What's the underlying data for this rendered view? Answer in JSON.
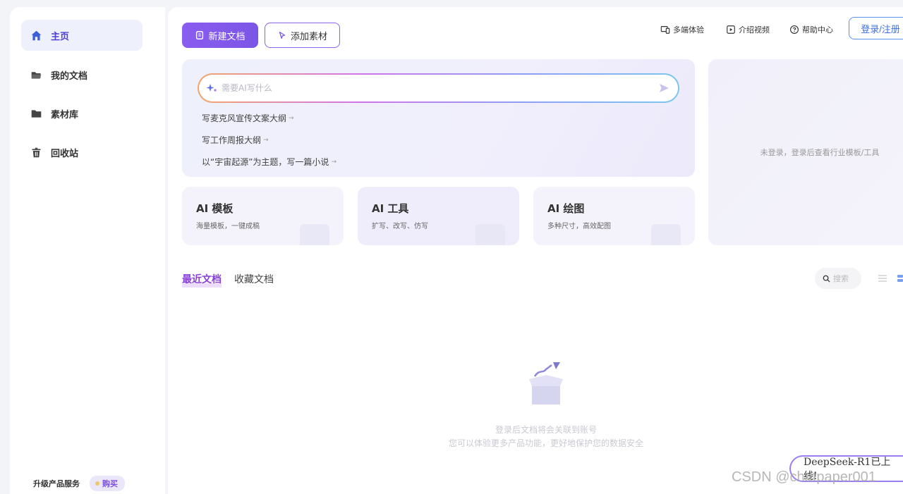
{
  "sidebar": {
    "items": [
      {
        "label": "主页",
        "icon": "home-icon",
        "active": true
      },
      {
        "label": "我的文档",
        "icon": "folder-open-icon",
        "active": false
      },
      {
        "label": "素材库",
        "icon": "folder-icon",
        "active": false
      },
      {
        "label": "回收站",
        "icon": "trash-icon",
        "active": false
      }
    ],
    "upgrade_label": "升级产品服务",
    "buy_label": "购买"
  },
  "header": {
    "new_doc_label": "新建文档",
    "add_material_label": "添加素材",
    "multi_device_label": "多端体验",
    "intro_video_label": "介绍视频",
    "help_center_label": "帮助中心",
    "login_label": "登录/注册"
  },
  "ai": {
    "placeholder": "需要AI写什么",
    "suggestions": [
      "写麦克风宣传文案大纲",
      "写工作周报大纲",
      "以“宇宙起源”为主题，写一篇小说"
    ]
  },
  "cards": [
    {
      "title": "AI 模板",
      "subtitle": "海量模板，一键成稿"
    },
    {
      "title": "AI 工具",
      "subtitle": "扩写、改写、仿写"
    },
    {
      "title": "AI 绘图",
      "subtitle": "多种尺寸，高效配图"
    }
  ],
  "side_panel": {
    "message": "未登录，登录后查看行业模板/工具"
  },
  "docs": {
    "tab_recent": "最近文档",
    "tab_favorites": "收藏文档",
    "search_placeholder": "搜索",
    "empty_line1": "登录后文档将会关联到账号",
    "empty_line2": "您可以体验更多产品功能，更好地保护您的数据安全"
  },
  "badge": {
    "label": "DeepSeek-R1已上线!"
  },
  "watermark": "CSDN @chatpaper001",
  "colors": {
    "accent": "#7b56e6",
    "login": "#3b6fe0",
    "active_tab": "#8a3fd8"
  }
}
